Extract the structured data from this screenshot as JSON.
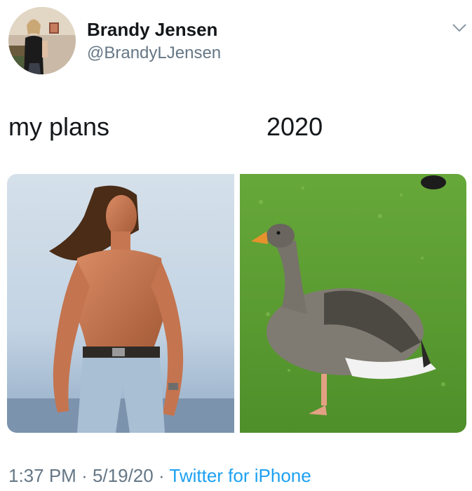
{
  "tweet": {
    "display_name": "Brandy Jensen",
    "handle": "@BrandyLJensen",
    "menu_icon": "chevron-down-icon",
    "captions": {
      "left": "my plans",
      "right": "2020"
    },
    "images": [
      {
        "subject": "shirtless long-haired man in jeans against sky"
      },
      {
        "subject": "grey goose standing on green grass"
      }
    ],
    "footer": {
      "time": "1:37 PM",
      "separator": "·",
      "date": "5/19/20",
      "source": "Twitter for iPhone"
    }
  },
  "colors": {
    "text": "#14171a",
    "secondary": "#657786",
    "link": "#1da1f2"
  }
}
